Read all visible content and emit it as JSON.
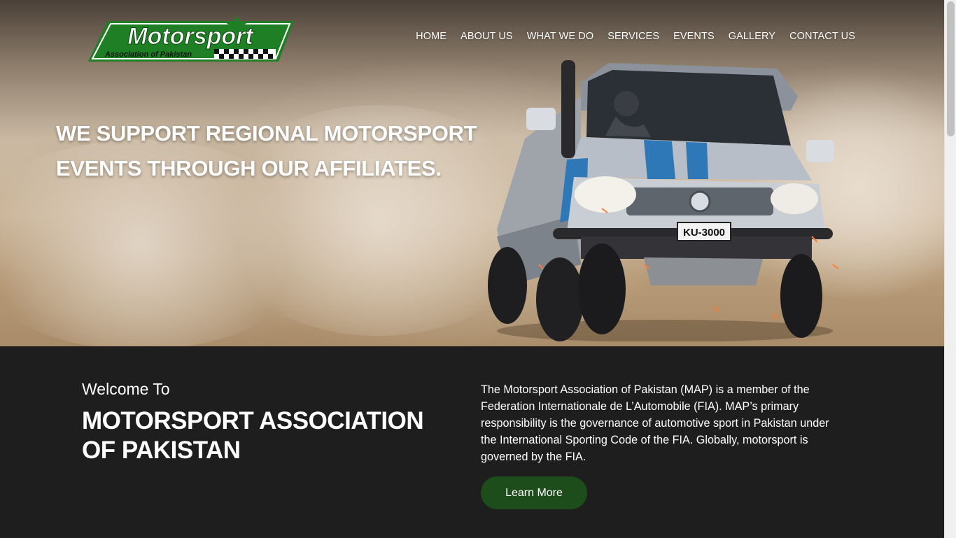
{
  "brand": {
    "logo_title": "Motorsport",
    "logo_subtitle": "Association of Pakistan",
    "accent_green": "#2e8b2e",
    "button_green": "#1d4d1a"
  },
  "nav": {
    "items": [
      {
        "label": "HOME"
      },
      {
        "label": "ABOUT US"
      },
      {
        "label": "WHAT WE DO"
      },
      {
        "label": "SERVICES"
      },
      {
        "label": "EVENTS"
      },
      {
        "label": "GALLERY"
      },
      {
        "label": "CONTACT US"
      }
    ]
  },
  "hero": {
    "headline_line1": "WE SUPPORT REGIONAL MOTORSPORT",
    "headline_line2": "EVENTS THROUGH OUR AFFILIATES.",
    "plate_text": "KU-3000"
  },
  "about": {
    "welcome": "Welcome To",
    "org_name": "MOTORSPORT ASSOCIATION OF PAKISTAN",
    "description": "The Motorsport Association of Pakistan (MAP) is a member of the Federation Internationale de L’Automobile (FIA). MAP’s primary responsibility is the governance of automotive sport in Pakistan under the International Sporting Code of the FIA. Globally, motorsport is governed by the FIA.",
    "button_label": "Learn More"
  }
}
